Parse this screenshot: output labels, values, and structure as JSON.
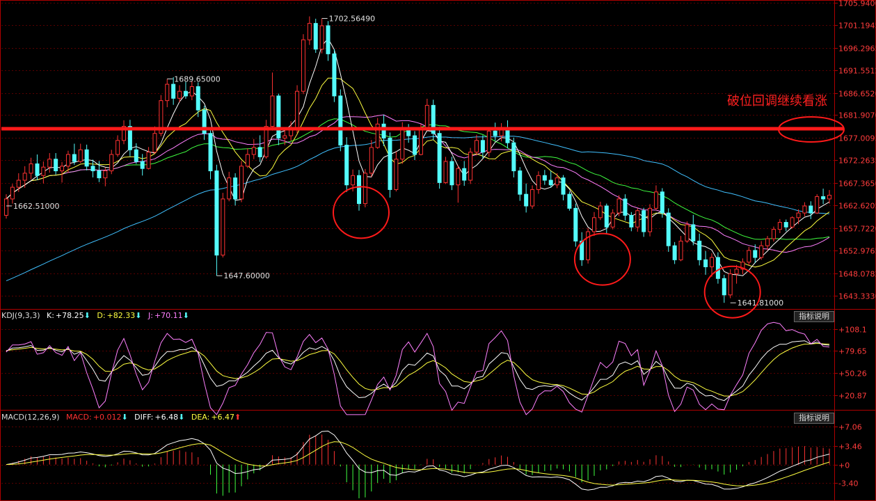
{
  "colors": {
    "background": "#000000",
    "up": "#ff3232",
    "down": "#54fcfc",
    "grid": "#5a0000",
    "axis": "#b00000",
    "ma5": "#ffffff",
    "ma10": "#ffff40",
    "ma20": "#ff80ff",
    "ma30": "#40ff40",
    "ma60": "#40c0ff",
    "annotation": "#ff1a1a",
    "kdj_k": "#ffffff",
    "kdj_d": "#ffff40",
    "kdj_j": "#ff80ff",
    "macd_diff": "#ffffff",
    "macd_dea": "#ffff40"
  },
  "panels": {
    "kdj": {
      "title": "KDJ(9,3,3)",
      "k_label": "K:",
      "k_value": "+78.25",
      "d_label": "D:",
      "d_value": "+82.33",
      "j_label": "J:",
      "j_value": "+70.11",
      "button": "指标说明"
    },
    "macd": {
      "title": "MACD(12,26,9)",
      "macd_label": "MACD:",
      "macd_value": "+0.012",
      "diff_label": "DIFF:",
      "diff_value": "+6.48",
      "dea_label": "DEA:",
      "dea_value": "+6.47",
      "button": "指标说明"
    }
  },
  "annotation": {
    "text": "破位回调继续看涨",
    "level": 1679.0
  },
  "chart_data": [
    {
      "type": "candlestick",
      "panel": "price",
      "ylim": [
        1640.5,
        1706.5
      ],
      "y_ticks": [
        "1705.9400",
        "1701.1945",
        "1696.2965",
        "1691.5512",
        "1686.6520",
        "1681.9070",
        "1677.0093",
        "1672.2635",
        "1667.3650",
        "1662.6205",
        "1657.7220",
        "1652.9765",
        "1648.0782",
        "1643.3330"
      ],
      "price_labels": [
        {
          "text": "1702.56490",
          "value": 1702.5649,
          "bar": 51
        },
        {
          "text": "1689.65000",
          "value": 1689.65,
          "bar": 26
        },
        {
          "text": "1662.51000",
          "value": 1662.51,
          "bar": 0
        },
        {
          "text": "1647.60000",
          "value": 1647.6,
          "bar": 34
        },
        {
          "text": "1641.81000",
          "value": 1641.81,
          "bar": 117
        }
      ],
      "circled_lows": [
        {
          "bar": 57,
          "value": 1662
        },
        {
          "bar": 96,
          "value": 1652
        },
        {
          "bar": 117,
          "value": 1645
        }
      ],
      "horizontal_line": 1679.0,
      "ohlc": [
        [
          1660.5,
          1665.0,
          1659.8,
          1664.0
        ],
        [
          1664.0,
          1667.2,
          1663.0,
          1666.5
        ],
        [
          1666.5,
          1669.5,
          1665.5,
          1668.0
        ],
        [
          1668.0,
          1671.0,
          1666.4,
          1669.5
        ],
        [
          1669.5,
          1672.8,
          1668.2,
          1671.5
        ],
        [
          1671.5,
          1673.5,
          1668.0,
          1669.0
        ],
        [
          1669.0,
          1672.0,
          1667.3,
          1670.8
        ],
        [
          1670.8,
          1673.8,
          1669.6,
          1672.5
        ],
        [
          1672.5,
          1673.8,
          1669.2,
          1670.0
        ],
        [
          1670.0,
          1671.9,
          1667.5,
          1671.0
        ],
        [
          1671.0,
          1674.3,
          1669.6,
          1673.5
        ],
        [
          1673.5,
          1675.8,
          1671.3,
          1672.0
        ],
        [
          1672.0,
          1675.8,
          1671.7,
          1674.5
        ],
        [
          1674.5,
          1675.6,
          1670.1,
          1671.0
        ],
        [
          1671.0,
          1672.4,
          1668.6,
          1670.0
        ],
        [
          1670.0,
          1672.1,
          1667.6,
          1668.5
        ],
        [
          1668.5,
          1670.7,
          1666.7,
          1670.0
        ],
        [
          1670.0,
          1674.5,
          1669.3,
          1673.5
        ],
        [
          1673.5,
          1677.6,
          1673.0,
          1676.5
        ],
        [
          1676.5,
          1680.8,
          1675.7,
          1679.5
        ],
        [
          1679.5,
          1680.9,
          1673.1,
          1674.5
        ],
        [
          1674.5,
          1675.9,
          1671.5,
          1672.0
        ],
        [
          1672.0,
          1673.6,
          1669.0,
          1670.5
        ],
        [
          1670.5,
          1675.1,
          1670.3,
          1674.0
        ],
        [
          1674.0,
          1679.5,
          1673.6,
          1678.0
        ],
        [
          1678.0,
          1686.2,
          1677.4,
          1685.0
        ],
        [
          1685.0,
          1689.65,
          1683.6,
          1688.5
        ],
        [
          1688.5,
          1690.0,
          1684.1,
          1685.5
        ],
        [
          1685.5,
          1688.3,
          1684.7,
          1687.0
        ],
        [
          1687.0,
          1689.0,
          1685.4,
          1686.0
        ],
        [
          1686.0,
          1689.1,
          1685.1,
          1688.0
        ],
        [
          1688.0,
          1688.9,
          1681.5,
          1683.0
        ],
        [
          1683.0,
          1683.9,
          1676.6,
          1678.0
        ],
        [
          1678.0,
          1679.0,
          1668.2,
          1670.0
        ],
        [
          1670.0,
          1671.3,
          1647.6,
          1652.0
        ],
        [
          1652.0,
          1665.3,
          1651.5,
          1664.0
        ],
        [
          1664.0,
          1669.8,
          1663.5,
          1668.5
        ],
        [
          1668.5,
          1669.5,
          1662.6,
          1664.0
        ],
        [
          1664.0,
          1672.1,
          1663.3,
          1671.0
        ],
        [
          1671.0,
          1674.8,
          1670.6,
          1673.5
        ],
        [
          1673.5,
          1676.8,
          1672.5,
          1675.0
        ],
        [
          1675.0,
          1677.6,
          1671.9,
          1673.0
        ],
        [
          1673.0,
          1680.9,
          1672.6,
          1679.5
        ],
        [
          1679.5,
          1691.0,
          1678.6,
          1686.0
        ],
        [
          1686.0,
          1686.5,
          1675.5,
          1677.0
        ],
        [
          1677.0,
          1678.9,
          1675.5,
          1677.5
        ],
        [
          1677.5,
          1680.6,
          1676.4,
          1679.0
        ],
        [
          1679.0,
          1688.3,
          1678.0,
          1687.0
        ],
        [
          1687.0,
          1699.2,
          1686.4,
          1698.0
        ],
        [
          1698.0,
          1703.0,
          1696.9,
          1701.5
        ],
        [
          1701.5,
          1702.5,
          1695.2,
          1696.0
        ],
        [
          1696.0,
          1702.5649,
          1695.1,
          1701.0
        ],
        [
          1701.0,
          1702.0,
          1693.5,
          1695.0
        ],
        [
          1695.0,
          1696.0,
          1684.7,
          1686.0
        ],
        [
          1686.0,
          1687.4,
          1674.2,
          1675.5
        ],
        [
          1675.5,
          1677.2,
          1665.5,
          1667.0
        ],
        [
          1667.0,
          1670.3,
          1665.6,
          1669.0
        ],
        [
          1669.0,
          1670.2,
          1661.5,
          1663.0
        ],
        [
          1663.0,
          1670.4,
          1662.2,
          1669.5
        ],
        [
          1669.5,
          1676.6,
          1668.7,
          1675.0
        ],
        [
          1675.0,
          1681.3,
          1674.7,
          1680.0
        ],
        [
          1680.0,
          1682.0,
          1675.3,
          1677.0
        ],
        [
          1677.0,
          1678.2,
          1664.3,
          1666.0
        ],
        [
          1666.0,
          1674.1,
          1665.6,
          1672.5
        ],
        [
          1672.5,
          1680.4,
          1671.5,
          1679.0
        ],
        [
          1679.0,
          1680.0,
          1676.0,
          1677.5
        ],
        [
          1677.5,
          1678.5,
          1672.3,
          1673.5
        ],
        [
          1673.5,
          1680.0,
          1673.3,
          1679.0
        ],
        [
          1679.0,
          1685.4,
          1678.6,
          1684.0
        ],
        [
          1684.0,
          1685.2,
          1676.6,
          1678.0
        ],
        [
          1678.0,
          1679.4,
          1666.2,
          1667.5
        ],
        [
          1667.5,
          1673.0,
          1667.2,
          1672.0
        ],
        [
          1672.0,
          1673.0,
          1665.9,
          1667.0
        ],
        [
          1667.0,
          1671.2,
          1663.2,
          1670.5
        ],
        [
          1670.5,
          1672.1,
          1666.8,
          1668.0
        ],
        [
          1668.0,
          1674.9,
          1667.2,
          1674.0
        ],
        [
          1674.0,
          1677.7,
          1673.3,
          1676.5
        ],
        [
          1676.5,
          1677.6,
          1672.7,
          1674.0
        ],
        [
          1674.0,
          1679.3,
          1673.0,
          1678.5
        ],
        [
          1678.5,
          1680.3,
          1676.4,
          1677.5
        ],
        [
          1677.5,
          1680.2,
          1676.3,
          1679.0
        ],
        [
          1679.0,
          1680.8,
          1674.8,
          1676.0
        ],
        [
          1676.0,
          1677.1,
          1668.6,
          1670.0
        ],
        [
          1670.0,
          1670.8,
          1663.6,
          1665.0
        ],
        [
          1665.0,
          1667.3,
          1661.1,
          1662.5
        ],
        [
          1662.5,
          1666.9,
          1661.9,
          1666.0
        ],
        [
          1666.0,
          1669.9,
          1665.1,
          1669.0
        ],
        [
          1669.0,
          1670.2,
          1667.0,
          1668.0
        ],
        [
          1668.0,
          1670.0,
          1666.4,
          1667.0
        ],
        [
          1667.0,
          1669.5,
          1666.3,
          1668.5
        ],
        [
          1668.5,
          1669.1,
          1663.7,
          1665.0
        ],
        [
          1665.0,
          1665.6,
          1661.5,
          1662.0
        ],
        [
          1662.0,
          1663.0,
          1653.8,
          1655.0
        ],
        [
          1655.0,
          1656.9,
          1649.7,
          1651.0
        ],
        [
          1651.0,
          1657.8,
          1650.2,
          1657.0
        ],
        [
          1657.0,
          1661.2,
          1656.1,
          1660.0
        ],
        [
          1660.0,
          1663.4,
          1659.5,
          1662.5
        ],
        [
          1662.5,
          1663.0,
          1656.4,
          1658.0
        ],
        [
          1658.0,
          1661.8,
          1657.5,
          1661.0
        ],
        [
          1661.0,
          1664.8,
          1660.3,
          1664.0
        ],
        [
          1664.0,
          1665.0,
          1659.4,
          1660.5
        ],
        [
          1660.5,
          1661.2,
          1657.1,
          1658.0
        ],
        [
          1658.0,
          1662.0,
          1657.0,
          1661.5
        ],
        [
          1661.5,
          1662.1,
          1655.9,
          1657.0
        ],
        [
          1657.0,
          1662.9,
          1656.0,
          1662.0
        ],
        [
          1662.0,
          1666.9,
          1661.6,
          1665.5
        ],
        [
          1665.5,
          1666.3,
          1660.0,
          1661.0
        ],
        [
          1661.0,
          1662.0,
          1652.7,
          1654.0
        ],
        [
          1654.0,
          1654.8,
          1650.1,
          1651.0
        ],
        [
          1651.0,
          1656.1,
          1650.7,
          1655.0
        ],
        [
          1655.0,
          1659.2,
          1654.6,
          1658.5
        ],
        [
          1658.5,
          1660.6,
          1654.1,
          1655.0
        ],
        [
          1655.0,
          1656.6,
          1649.8,
          1651.0
        ],
        [
          1651.0,
          1652.9,
          1647.8,
          1649.5
        ],
        [
          1649.5,
          1652.4,
          1647.4,
          1651.5
        ],
        [
          1651.5,
          1652.6,
          1645.9,
          1647.0
        ],
        [
          1647.0,
          1647.8,
          1641.81,
          1643.5
        ],
        [
          1643.5,
          1649.0,
          1642.8,
          1648.0
        ],
        [
          1648.0,
          1649.9,
          1645.9,
          1649.0
        ],
        [
          1649.0,
          1651.3,
          1647.9,
          1650.5
        ],
        [
          1650.5,
          1653.8,
          1649.8,
          1653.0
        ],
        [
          1653.0,
          1654.3,
          1650.3,
          1651.5
        ],
        [
          1651.5,
          1655.0,
          1651.0,
          1654.0
        ],
        [
          1654.0,
          1656.1,
          1653.1,
          1655.5
        ],
        [
          1655.5,
          1658.1,
          1654.9,
          1657.5
        ],
        [
          1657.5,
          1659.7,
          1656.7,
          1659.0
        ],
        [
          1659.0,
          1659.6,
          1657.1,
          1658.0
        ],
        [
          1658.0,
          1660.3,
          1657.7,
          1660.0
        ],
        [
          1660.0,
          1661.8,
          1658.6,
          1661.0
        ],
        [
          1661.0,
          1663.3,
          1660.3,
          1662.5
        ],
        [
          1662.5,
          1663.5,
          1659.7,
          1661.0
        ],
        [
          1661.0,
          1665.0,
          1660.8,
          1664.5
        ],
        [
          1664.5,
          1666.2,
          1662.9,
          1664.0
        ],
        [
          1664.0,
          1665.9,
          1663.0,
          1664.8
        ]
      ]
    },
    {
      "type": "line",
      "panel": "kdj",
      "ylim": [
        5,
        118
      ],
      "y_ticks": [
        "+108.1",
        "+79.65",
        "+50.26",
        "+20.87"
      ],
      "series": [
        {
          "name": "K"
        },
        {
          "name": "D"
        },
        {
          "name": "J"
        }
      ],
      "last": {
        "K": 78.25,
        "D": 82.33,
        "J": 70.11
      }
    },
    {
      "type": "bar",
      "panel": "macd",
      "ylim": [
        -6.5,
        8.2
      ],
      "y_ticks": [
        "+7.06",
        "+3.46",
        "+0",
        "-3.40"
      ],
      "series": [
        {
          "name": "DIFF"
        },
        {
          "name": "DEA"
        },
        {
          "name": "MACD"
        }
      ],
      "last": {
        "MACD": 0.012,
        "DIFF": 6.48,
        "DEA": 6.47
      }
    }
  ]
}
